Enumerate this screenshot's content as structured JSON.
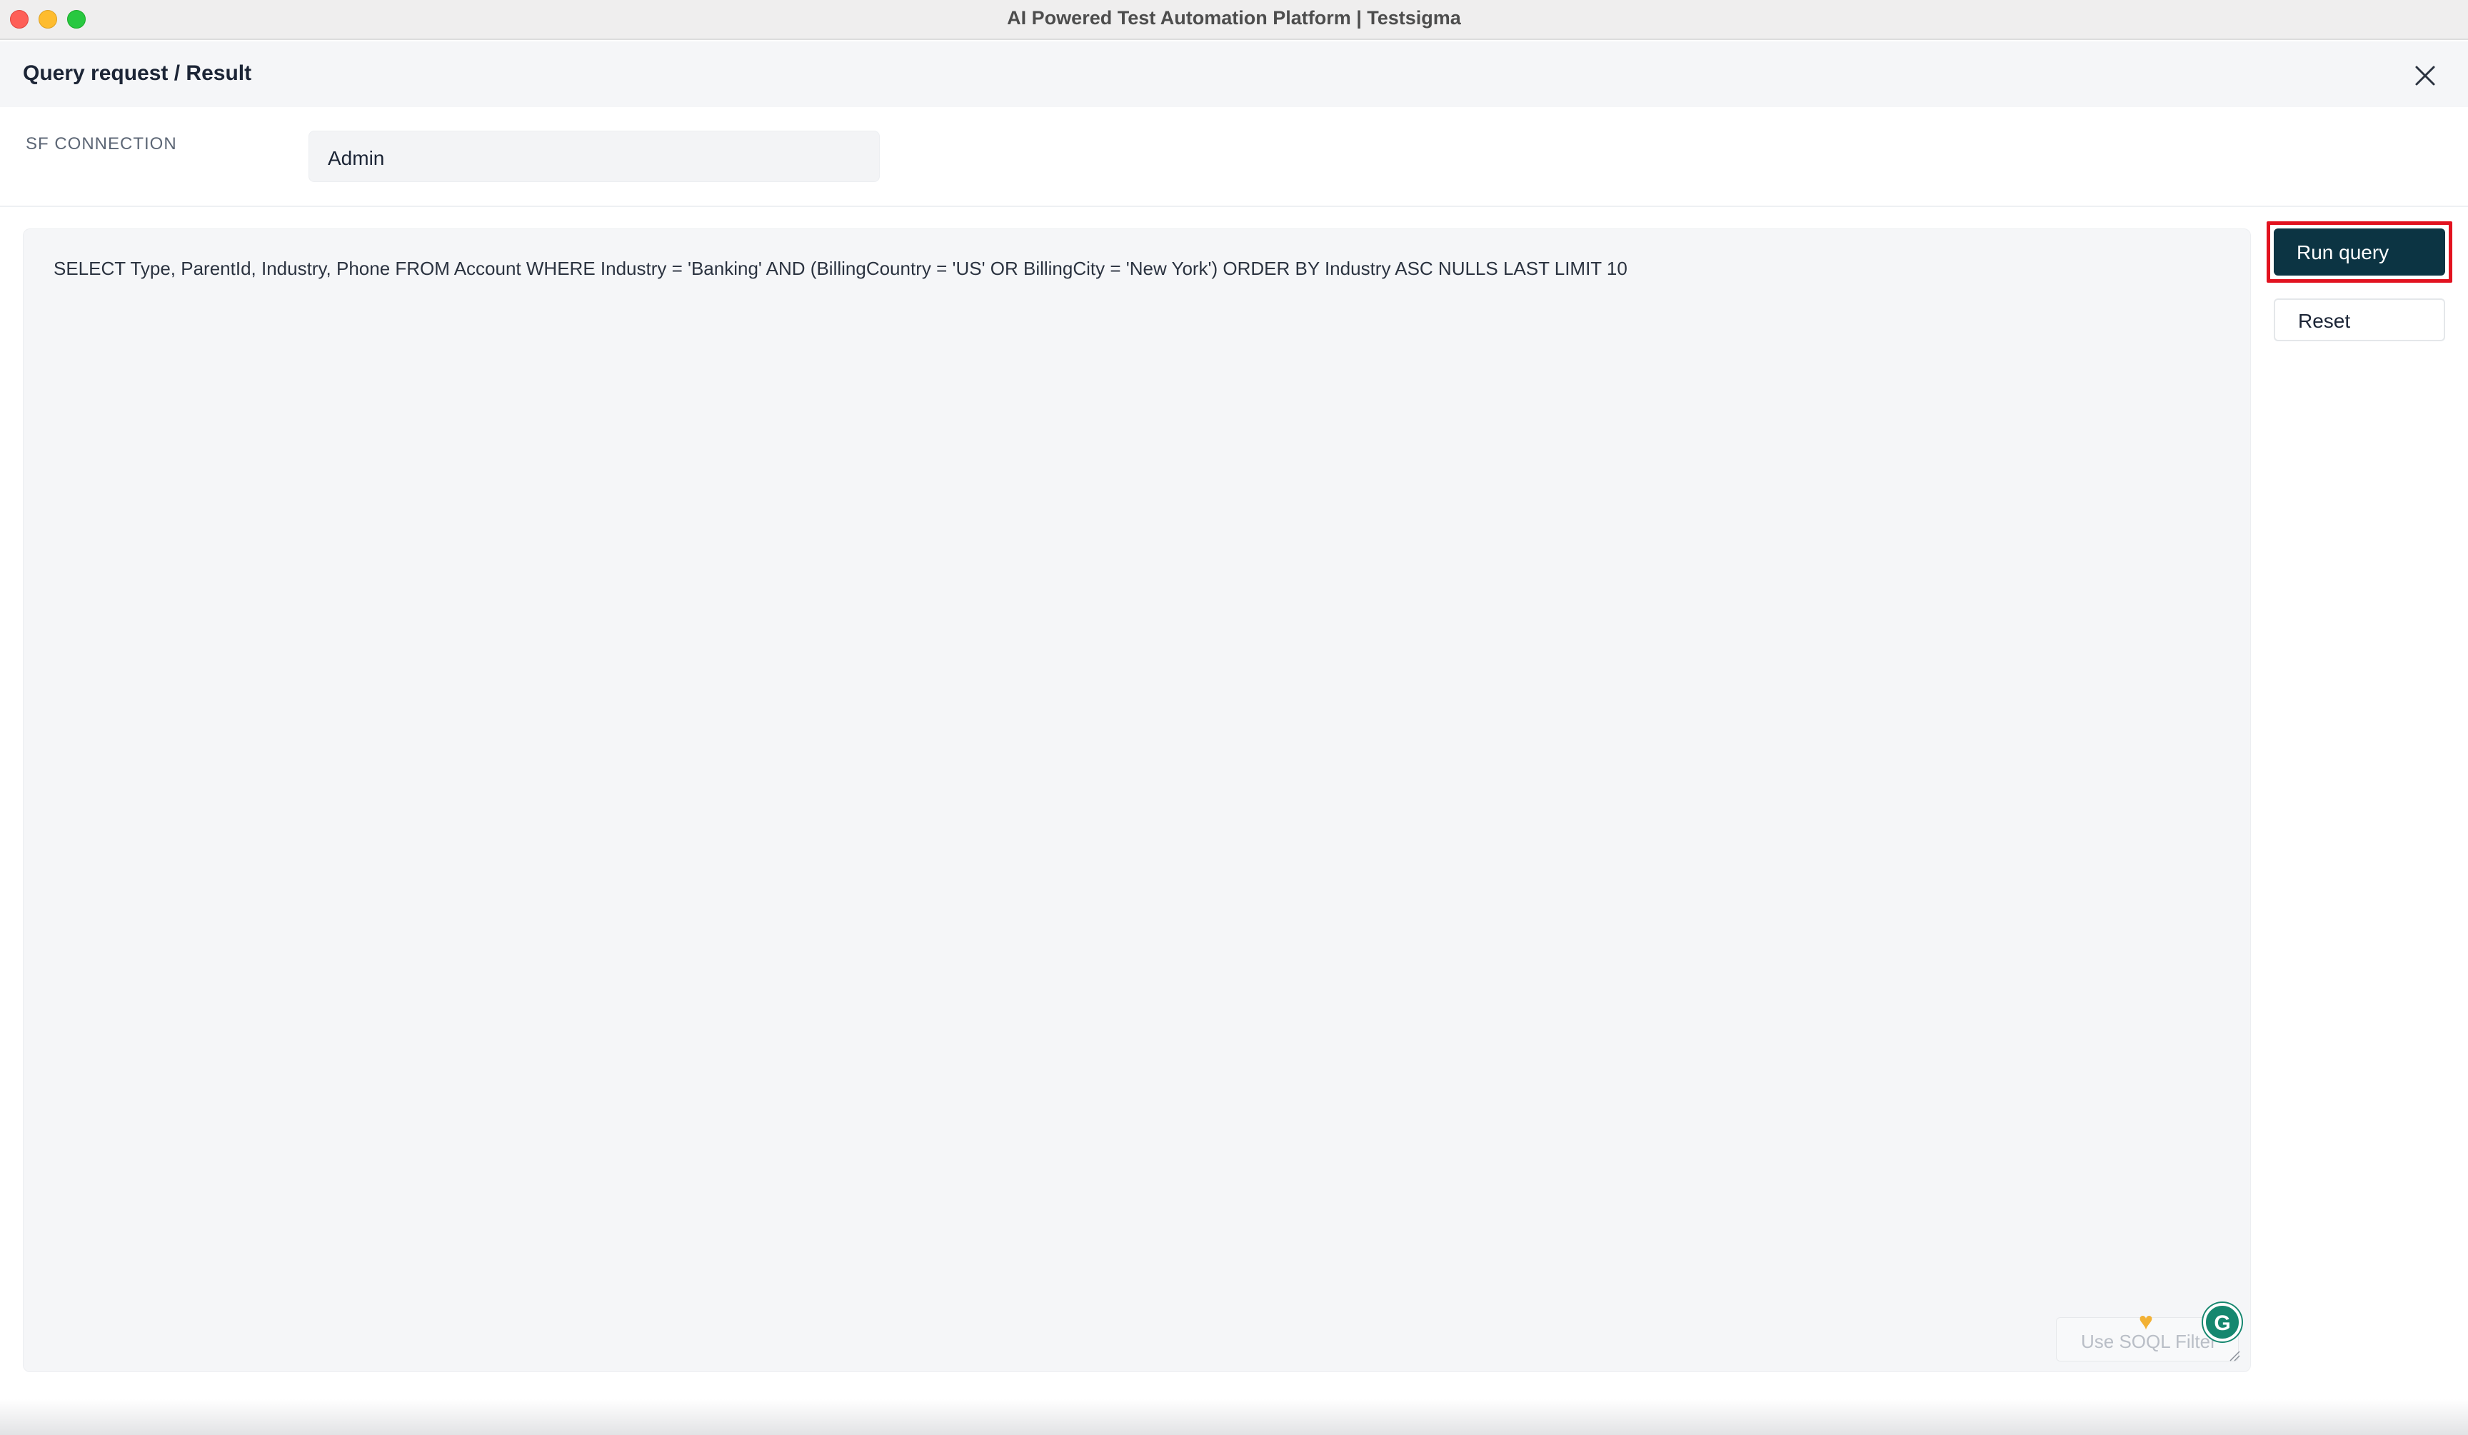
{
  "window": {
    "title": "AI Powered Test Automation Platform | Testsigma"
  },
  "dialog": {
    "title": "Query request / Result",
    "close_icon": "close-icon"
  },
  "connection": {
    "label": "SF CONNECTION",
    "value": "Admin"
  },
  "editor": {
    "query": "SELECT Type, ParentId, Industry, Phone FROM Account WHERE Industry = 'Banking' AND (BillingCountry = 'US' OR BillingCity = 'New York') ORDER BY Industry ASC NULLS LAST LIMIT 10",
    "soql_filter_label": "Use SOQL Filter",
    "grammarly_letter": "G"
  },
  "actions": {
    "run_label": "Run query",
    "reset_label": "Reset",
    "run_color": "#0c3443",
    "highlight_color": "#e2121f"
  }
}
